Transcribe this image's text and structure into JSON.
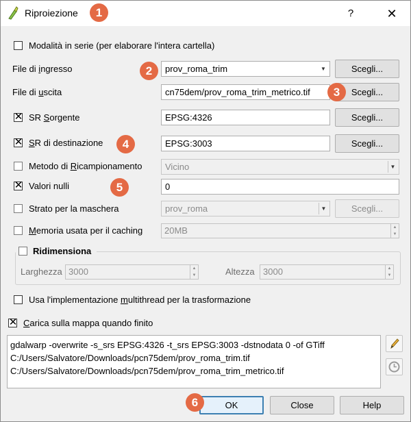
{
  "window": {
    "title": "Riproiezione",
    "help_glyph": "?",
    "close_glyph": "✕"
  },
  "badges": [
    "1",
    "2",
    "3",
    "4",
    "5",
    "6"
  ],
  "batch_mode": {
    "label": "Modalità in serie (per elaborare l'intera cartella)",
    "checked": false
  },
  "input_file": {
    "label_pre": "File di ",
    "label_mnemonic": "i",
    "label_post": "ngresso",
    "value": "prov_roma_trim",
    "button": "Scegli..."
  },
  "output_file": {
    "label_pre": "File di ",
    "label_mnemonic": "u",
    "label_post": "scita",
    "value": "cn75dem/prov_roma_trim_metrico.tif",
    "button": "Scegli..."
  },
  "source_srs": {
    "label_pre": "SR ",
    "label_mnemonic": "S",
    "label_post": "orgente",
    "checked": true,
    "value": "EPSG:4326",
    "button": "Scegli..."
  },
  "dest_srs": {
    "label_pre": "",
    "label_mnemonic": "S",
    "label_post": "R di destinazione",
    "checked": true,
    "value": "EPSG:3003",
    "button": "Scegli..."
  },
  "resampling": {
    "label_pre": "Metodo di ",
    "label_mnemonic": "R",
    "label_post": "icampionamento",
    "checked": false,
    "value": "Vicino"
  },
  "nodata": {
    "label": "Valori nulli",
    "checked": true,
    "value": "0"
  },
  "mask_layer": {
    "label": "Strato per la maschera",
    "checked": false,
    "value": "prov_roma",
    "button": "Scegli..."
  },
  "cache_memory": {
    "label_pre": "",
    "label_mnemonic": "M",
    "label_post": "emoria usata per il caching",
    "checked": false,
    "value": "20MB"
  },
  "resize": {
    "label": "Ridimensiona",
    "checked": false,
    "width_label": "Larghezza",
    "width_value": "3000",
    "height_label": "Altezza",
    "height_value": "3000"
  },
  "multithread": {
    "label_pre": "Usa l'implementazione ",
    "label_mnemonic": "m",
    "label_post": "ultithread per la trasformazione",
    "checked": false
  },
  "load_on_finish": {
    "label_pre": "",
    "label_mnemonic": "C",
    "label_post": "arica sulla mappa quando finito",
    "checked": true
  },
  "command": {
    "lines": [
      "gdalwarp -overwrite -s_srs EPSG:4326 -t_srs EPSG:3003 -dstnodata 0 -of GTiff",
      "C:/Users/Salvatore/Downloads/pcn75dem/prov_roma_trim.tif",
      "C:/Users/Salvatore/Downloads/pcn75dem/prov_roma_trim_metrico.tif"
    ],
    "edit_icon": "pencil-icon",
    "reset_icon": "reset-icon"
  },
  "buttons": {
    "ok": "OK",
    "close": "Close",
    "help": "Help"
  },
  "colors": {
    "badge": "#e46a45",
    "default_button_border": "#3c7fb1"
  }
}
